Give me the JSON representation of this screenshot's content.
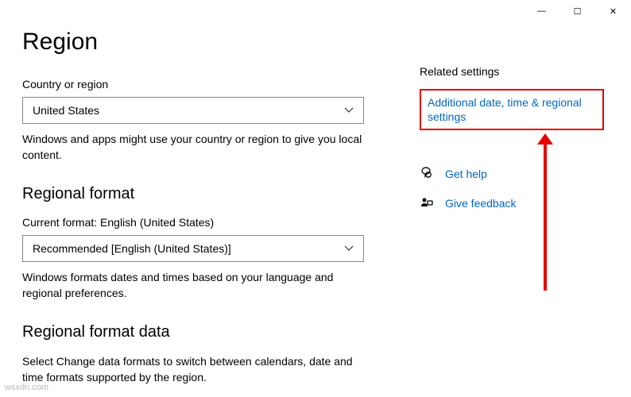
{
  "titlebar": {
    "minimize": "—",
    "maximize": "☐",
    "close": "✕"
  },
  "page": {
    "title": "Region"
  },
  "country": {
    "label": "Country or region",
    "value": "United States",
    "desc": "Windows and apps might use your country or region to give you local content."
  },
  "regional_format": {
    "heading": "Regional format",
    "current_label": "Current format: English (United States)",
    "value": "Recommended [English (United States)]",
    "desc": "Windows formats dates and times based on your language and regional preferences."
  },
  "regional_format_data": {
    "heading": "Regional format data",
    "desc": "Select Change data formats to switch between calendars, date and time formats supported by the region."
  },
  "related": {
    "heading": "Related settings",
    "additional_link": "Additional date, time & regional settings",
    "get_help": "Get help",
    "give_feedback": "Give feedback"
  },
  "watermark": "wsxdn.com"
}
